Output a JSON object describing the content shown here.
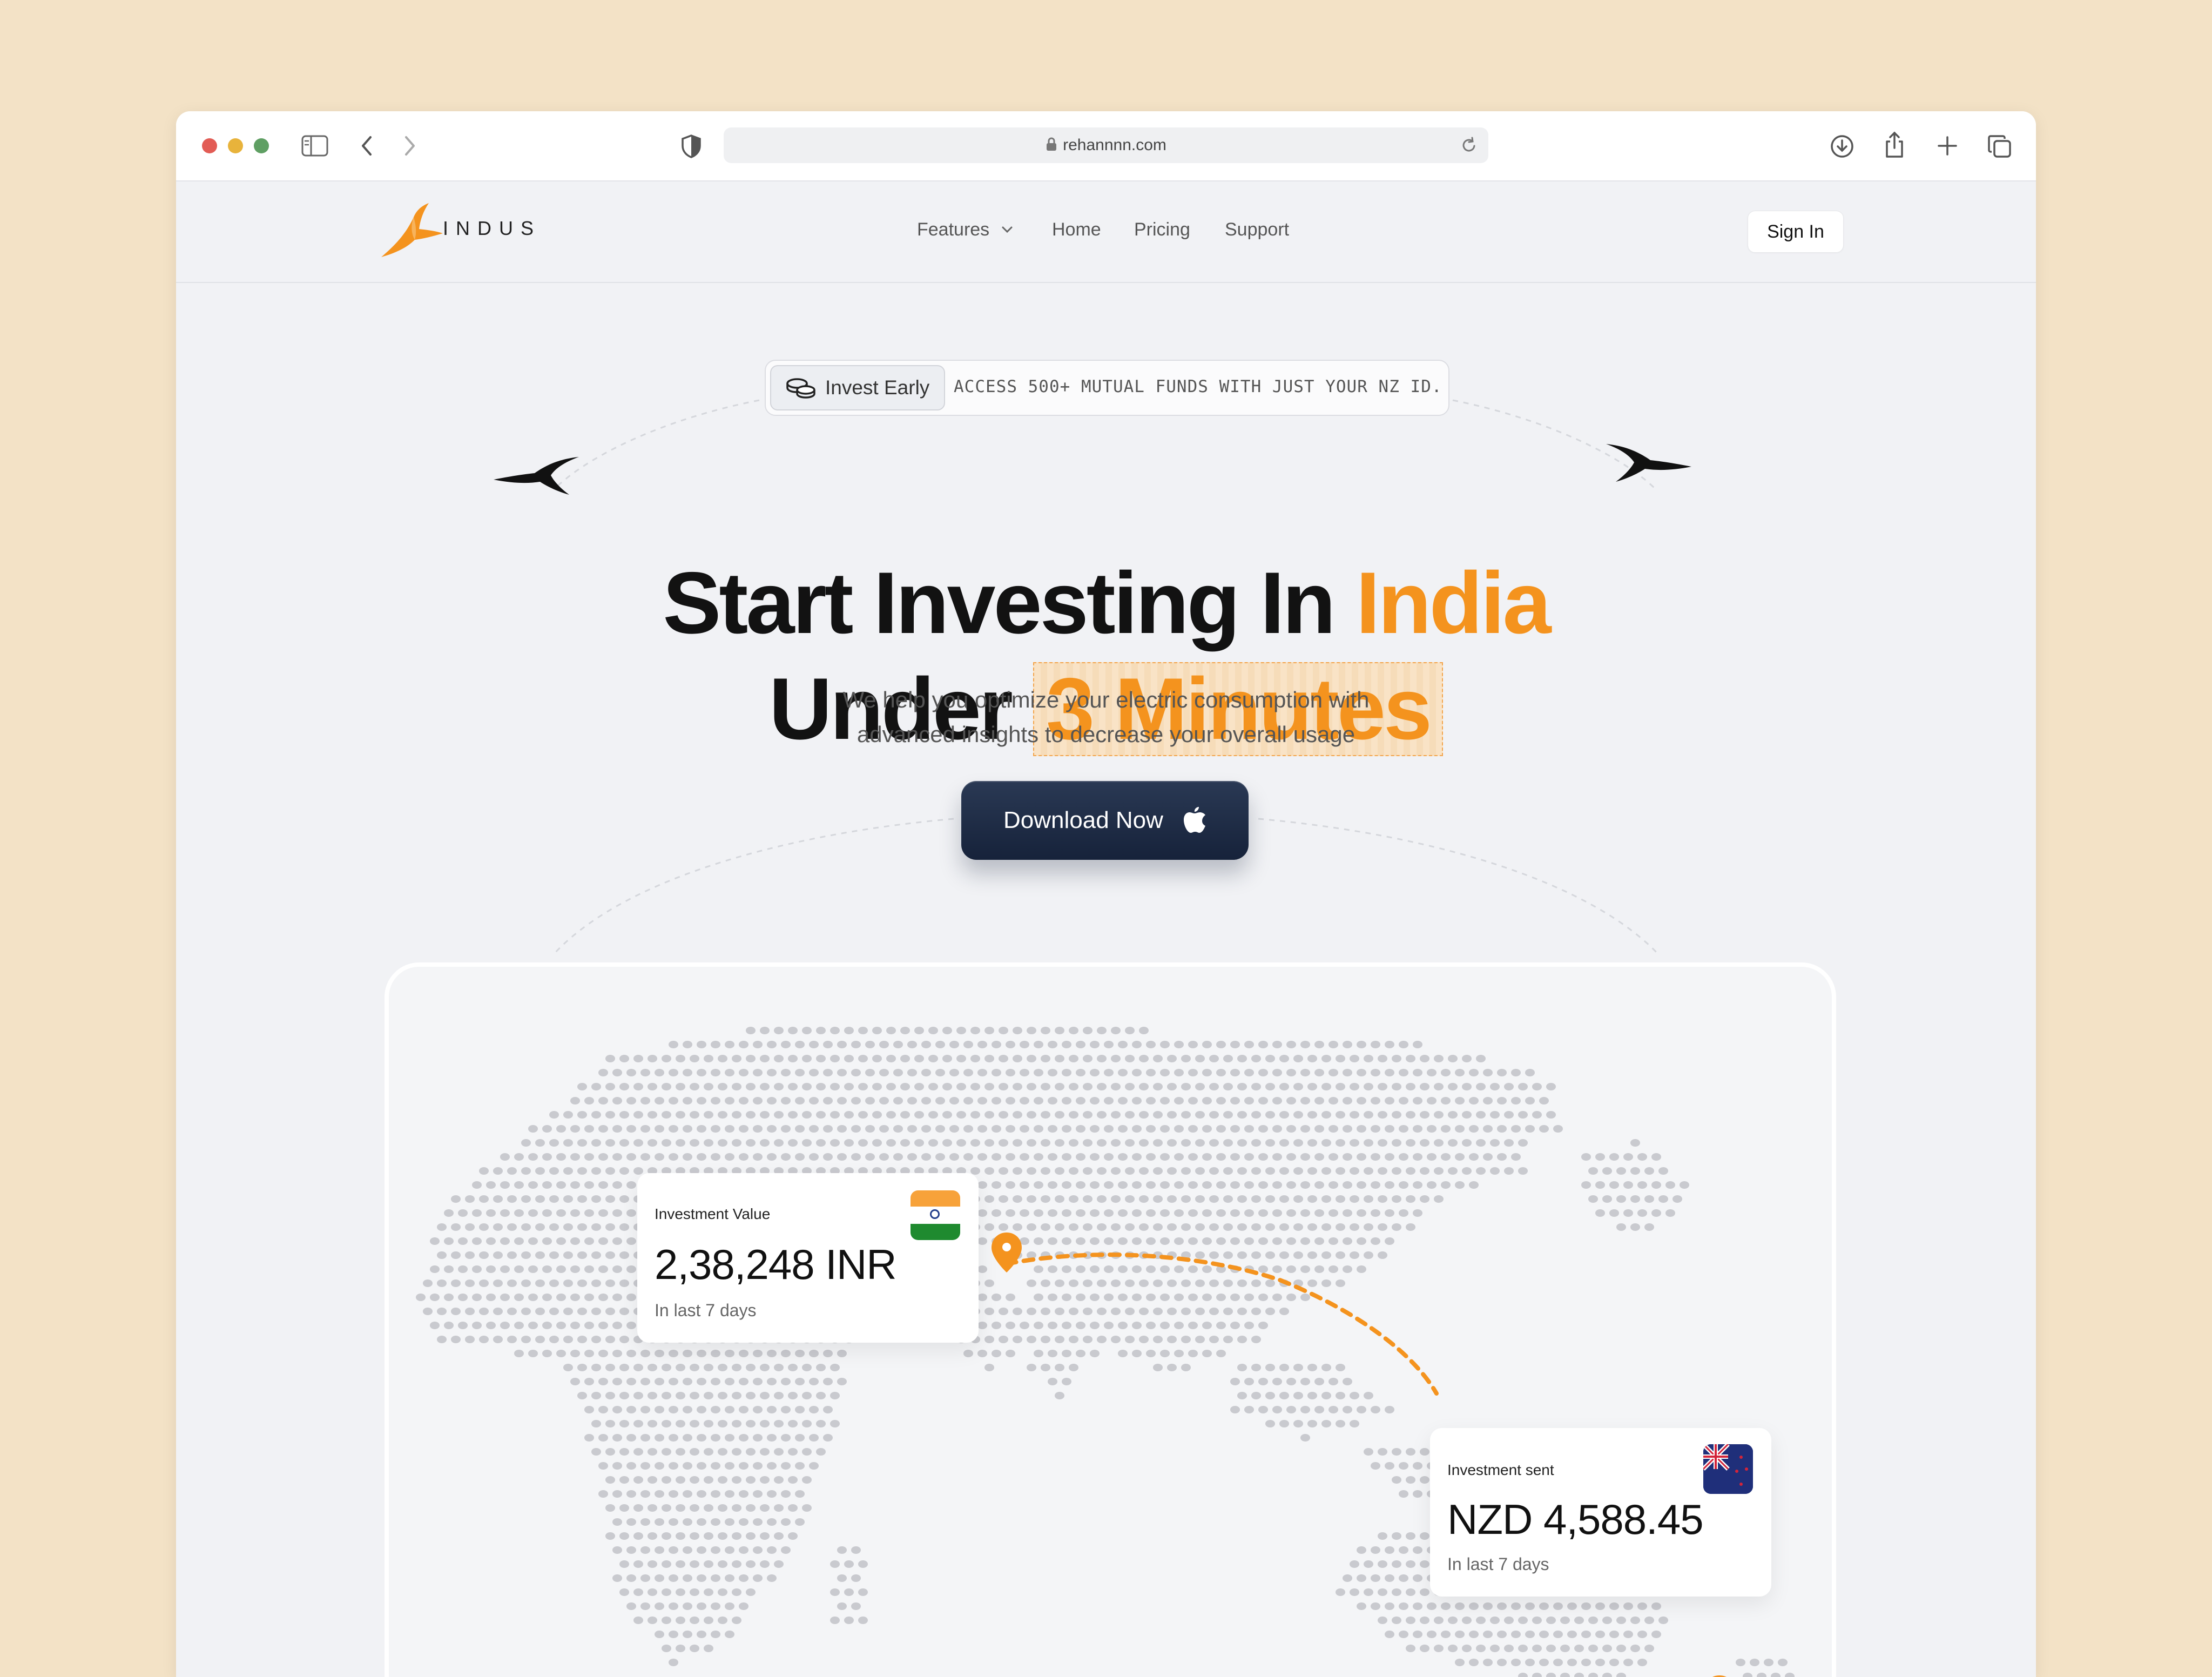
{
  "browser": {
    "url": "rehannnn.com"
  },
  "nav": {
    "logo_text": "INDUS",
    "links": [
      "Features",
      "Home",
      "Pricing",
      "Support"
    ],
    "sign_in": "Sign In"
  },
  "hero": {
    "badge_pill": "Invest Early",
    "badge_text": "ACCESS 500+ MUTUAL FUNDS WITH JUST YOUR NZ ID.",
    "headline_part1": "Start Investing In ",
    "headline_accent1": "India",
    "headline_part2": "Under ",
    "headline_accent2": "3 Minutes",
    "subtext_line1": "We help you optimize your electric consumption with",
    "subtext_line2": "advanced insights to decrease your overall usage",
    "cta_label": "Download Now"
  },
  "map": {
    "card_india": {
      "label": "Investment Value",
      "value": "2,38,248 INR",
      "sub": "In last 7 days"
    },
    "card_nz": {
      "label": "Investment sent",
      "value": "NZD 4,588.45",
      "sub": "In last 7 days"
    }
  },
  "colors": {
    "accent": "#f4931e",
    "cta_bg": "#1e2a44",
    "page_bg": "#f1f2f5",
    "outer_bg": "#f3e2c6"
  }
}
